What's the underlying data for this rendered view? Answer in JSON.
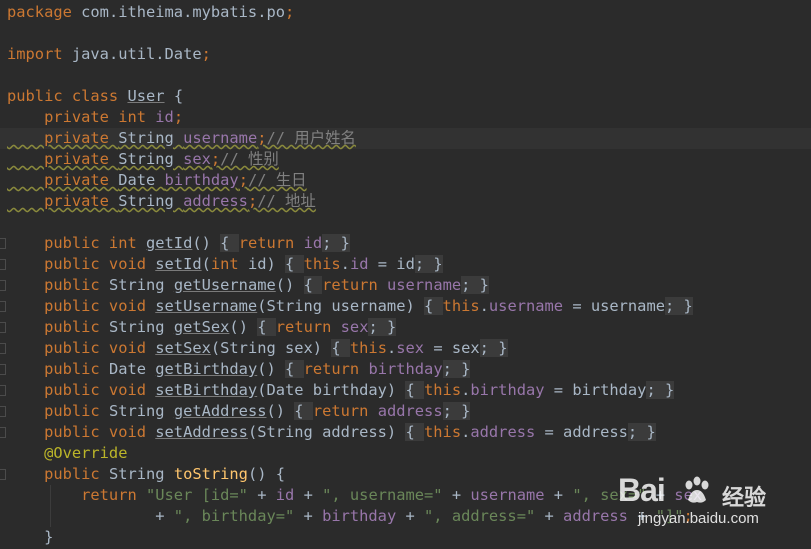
{
  "editor": {
    "lines": [
      [
        {
          "t": "package ",
          "c": "kw"
        },
        {
          "t": "com.itheima.mybatis.po"
        },
        {
          "t": ";",
          "c": "kw"
        }
      ],
      [],
      [
        {
          "t": "import ",
          "c": "kw"
        },
        {
          "t": "java.util.Date"
        },
        {
          "t": ";",
          "c": "kw"
        }
      ],
      [],
      [
        {
          "t": "public class ",
          "c": "kw"
        },
        {
          "t": "User",
          "u": true
        },
        {
          "t": " {"
        }
      ],
      [
        {
          "t": "    private int ",
          "c": "kw"
        },
        {
          "t": "id",
          "c": "fd"
        },
        {
          "t": ";",
          "c": "kw"
        }
      ],
      [
        {
          "t": "    private ",
          "c": "kw"
        },
        {
          "t": "String "
        },
        {
          "t": "username",
          "c": "fd"
        },
        {
          "t": ";",
          "c": "kw"
        },
        {
          "t": "// 用户姓名",
          "c": "cm"
        }
      ],
      [
        {
          "t": "    private ",
          "c": "kw"
        },
        {
          "t": "String "
        },
        {
          "t": "sex",
          "c": "fd"
        },
        {
          "t": ";",
          "c": "kw"
        },
        {
          "t": "// 性别",
          "c": "cm"
        }
      ],
      [
        {
          "t": "    private ",
          "c": "kw"
        },
        {
          "t": "Date "
        },
        {
          "t": "birthday",
          "c": "fd"
        },
        {
          "t": ";",
          "c": "kw"
        },
        {
          "t": "// 生日",
          "c": "cm"
        }
      ],
      [
        {
          "t": "    private ",
          "c": "kw"
        },
        {
          "t": "String "
        },
        {
          "t": "address",
          "c": "fd"
        },
        {
          "t": ";",
          "c": "kw"
        },
        {
          "t": "// 地址",
          "c": "cm"
        }
      ],
      [],
      [
        {
          "t": "    public int ",
          "c": "kw"
        },
        {
          "t": "getId",
          "u": true
        },
        {
          "t": "() "
        },
        {
          "t": "{ ",
          "f": true
        },
        {
          "t": "return ",
          "c": "kw"
        },
        {
          "t": "id",
          "c": "fd"
        },
        {
          "t": "; ",
          "c": "kw",
          "f": true
        },
        {
          "t": "}",
          "f": true
        }
      ],
      [
        {
          "t": "    public void ",
          "c": "kw"
        },
        {
          "t": "setId",
          "u": true
        },
        {
          "t": "("
        },
        {
          "t": "int ",
          "c": "kw"
        },
        {
          "t": "id) "
        },
        {
          "t": "{ ",
          "f": true
        },
        {
          "t": "this",
          "c": "kw"
        },
        {
          "t": "."
        },
        {
          "t": "id",
          "c": "fd"
        },
        {
          "t": " = id"
        },
        {
          "t": "; ",
          "c": "kw",
          "f": true
        },
        {
          "t": "}",
          "f": true
        }
      ],
      [
        {
          "t": "    public ",
          "c": "kw"
        },
        {
          "t": "String "
        },
        {
          "t": "getUsername",
          "u": true
        },
        {
          "t": "() "
        },
        {
          "t": "{ ",
          "f": true
        },
        {
          "t": "return ",
          "c": "kw"
        },
        {
          "t": "username",
          "c": "fd"
        },
        {
          "t": "; ",
          "c": "kw",
          "f": true
        },
        {
          "t": "}",
          "f": true
        }
      ],
      [
        {
          "t": "    public void ",
          "c": "kw"
        },
        {
          "t": "setUsername",
          "u": true
        },
        {
          "t": "(String username) "
        },
        {
          "t": "{ ",
          "f": true
        },
        {
          "t": "this",
          "c": "kw"
        },
        {
          "t": "."
        },
        {
          "t": "username",
          "c": "fd"
        },
        {
          "t": " = username"
        },
        {
          "t": "; ",
          "c": "kw",
          "f": true
        },
        {
          "t": "}",
          "f": true
        }
      ],
      [
        {
          "t": "    public ",
          "c": "kw"
        },
        {
          "t": "String "
        },
        {
          "t": "getSex",
          "u": true
        },
        {
          "t": "() "
        },
        {
          "t": "{ ",
          "f": true
        },
        {
          "t": "return ",
          "c": "kw"
        },
        {
          "t": "sex",
          "c": "fd"
        },
        {
          "t": "; ",
          "c": "kw",
          "f": true
        },
        {
          "t": "}",
          "f": true
        }
      ],
      [
        {
          "t": "    public void ",
          "c": "kw"
        },
        {
          "t": "setSex",
          "u": true
        },
        {
          "t": "(String sex) "
        },
        {
          "t": "{ ",
          "f": true
        },
        {
          "t": "this",
          "c": "kw"
        },
        {
          "t": "."
        },
        {
          "t": "sex",
          "c": "fd"
        },
        {
          "t": " = sex"
        },
        {
          "t": "; ",
          "c": "kw",
          "f": true
        },
        {
          "t": "}",
          "f": true
        }
      ],
      [
        {
          "t": "    public ",
          "c": "kw"
        },
        {
          "t": "Date "
        },
        {
          "t": "getBirthday",
          "u": true
        },
        {
          "t": "() "
        },
        {
          "t": "{ ",
          "f": true
        },
        {
          "t": "return ",
          "c": "kw"
        },
        {
          "t": "birthday",
          "c": "fd"
        },
        {
          "t": "; ",
          "c": "kw",
          "f": true
        },
        {
          "t": "}",
          "f": true
        }
      ],
      [
        {
          "t": "    public void ",
          "c": "kw"
        },
        {
          "t": "setBirthday",
          "u": true
        },
        {
          "t": "(Date birthday) "
        },
        {
          "t": "{ ",
          "f": true
        },
        {
          "t": "this",
          "c": "kw"
        },
        {
          "t": "."
        },
        {
          "t": "birthday",
          "c": "fd"
        },
        {
          "t": " = birthday"
        },
        {
          "t": "; ",
          "c": "kw",
          "f": true
        },
        {
          "t": "}",
          "f": true
        }
      ],
      [
        {
          "t": "    public ",
          "c": "kw"
        },
        {
          "t": "String "
        },
        {
          "t": "getAddress",
          "u": true
        },
        {
          "t": "() "
        },
        {
          "t": "{ ",
          "f": true
        },
        {
          "t": "return ",
          "c": "kw"
        },
        {
          "t": "address",
          "c": "fd"
        },
        {
          "t": "; ",
          "c": "kw",
          "f": true
        },
        {
          "t": "}",
          "f": true
        }
      ],
      [
        {
          "t": "    public void ",
          "c": "kw"
        },
        {
          "t": "setAddress",
          "u": true
        },
        {
          "t": "(String address) "
        },
        {
          "t": "{ ",
          "f": true
        },
        {
          "t": "this",
          "c": "kw"
        },
        {
          "t": "."
        },
        {
          "t": "address",
          "c": "fd"
        },
        {
          "t": " = address"
        },
        {
          "t": "; ",
          "c": "kw",
          "f": true
        },
        {
          "t": "}",
          "f": true
        }
      ],
      [
        {
          "t": "    @Override",
          "c": "an"
        }
      ],
      [
        {
          "t": "    public ",
          "c": "kw"
        },
        {
          "t": "String "
        },
        {
          "t": "toString",
          "c": "fn"
        },
        {
          "t": "() {"
        }
      ],
      [
        {
          "t": "        return ",
          "c": "kw"
        },
        {
          "t": "\"User [id=\"",
          "c": "st"
        },
        {
          "t": " + "
        },
        {
          "t": "id",
          "c": "fd"
        },
        {
          "t": " + "
        },
        {
          "t": "\", username=\"",
          "c": "st"
        },
        {
          "t": " + "
        },
        {
          "t": "username",
          "c": "fd"
        },
        {
          "t": " + "
        },
        {
          "t": "\", sex=\"",
          "c": "st"
        },
        {
          "t": " + "
        },
        {
          "t": "sex",
          "c": "fd"
        }
      ],
      [
        {
          "t": "                + "
        },
        {
          "t": "\", birthday=\"",
          "c": "st"
        },
        {
          "t": " + "
        },
        {
          "t": "birthday",
          "c": "fd"
        },
        {
          "t": " + "
        },
        {
          "t": "\", address=\"",
          "c": "st"
        },
        {
          "t": " + "
        },
        {
          "t": "address",
          "c": "fd"
        },
        {
          "t": " + "
        },
        {
          "t": "\"]\"",
          "c": "st"
        },
        {
          "t": ";",
          "c": "kw"
        }
      ],
      [
        {
          "t": "    }"
        }
      ]
    ]
  },
  "watermark": {
    "brand": "Bai",
    "brand_cn": "经验",
    "domain": "jingyan.baidu.com"
  }
}
